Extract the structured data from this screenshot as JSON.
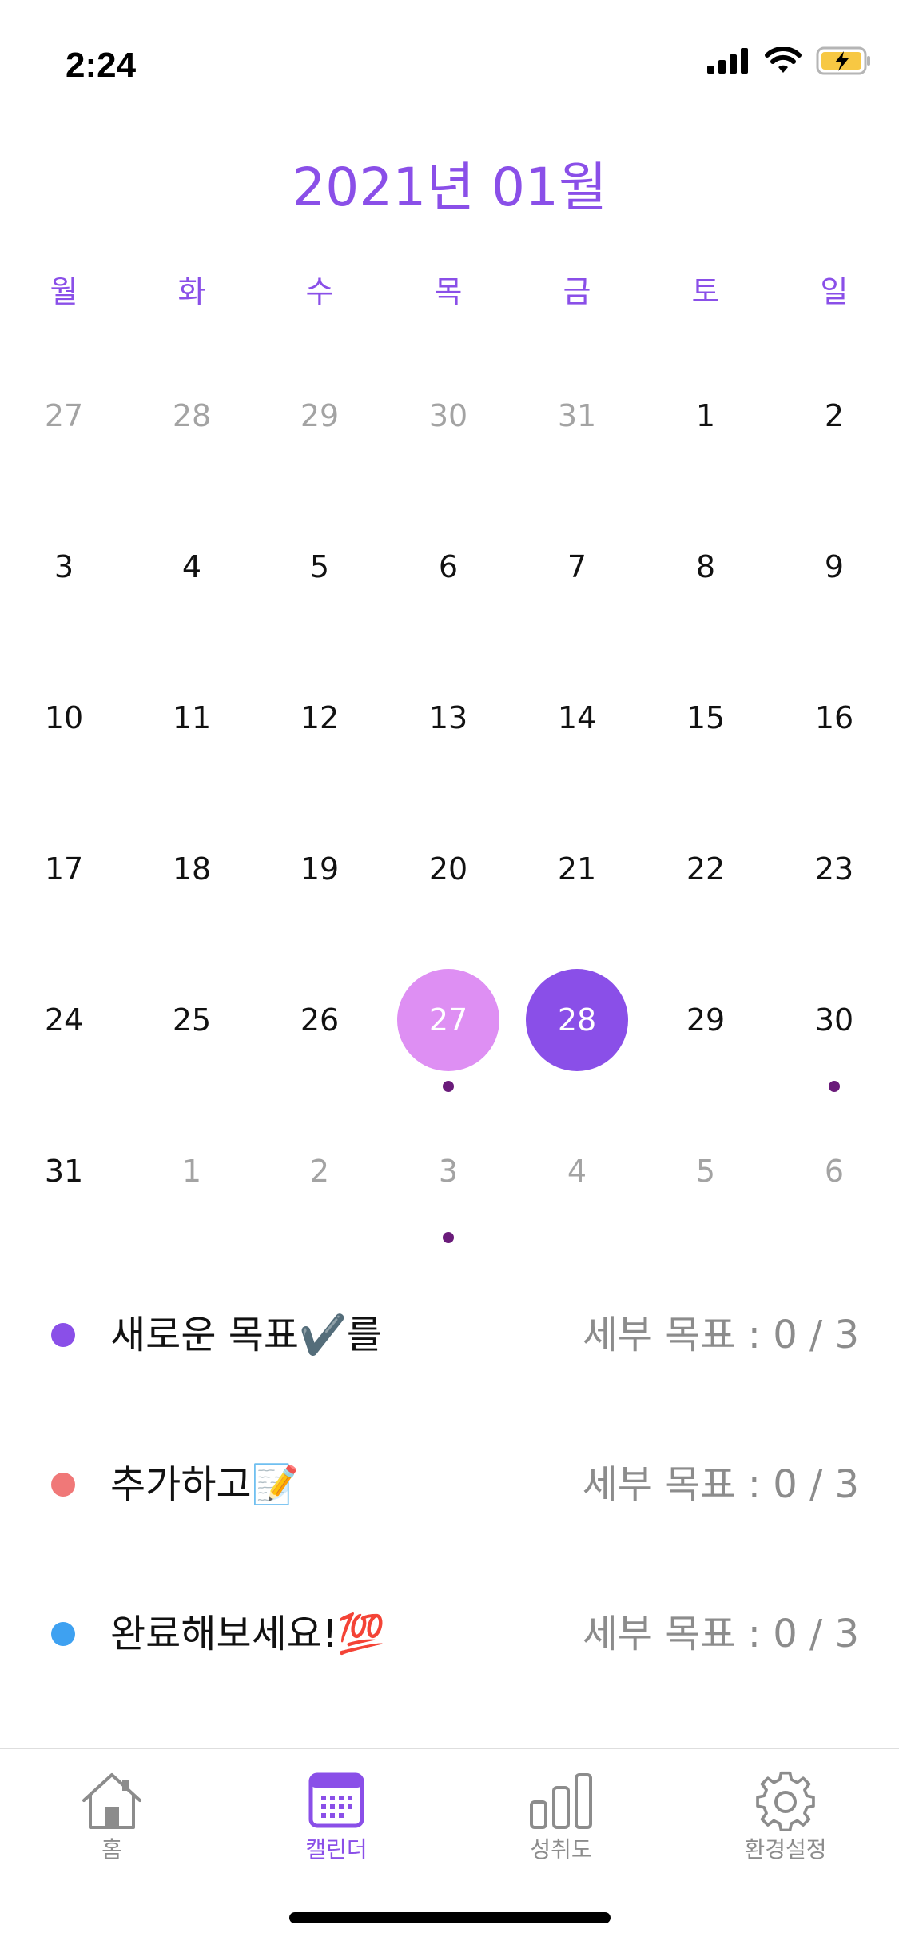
{
  "status_bar": {
    "time": "2:24",
    "icons": [
      "cellular-signal-icon",
      "wifi-icon",
      "battery-charging-icon"
    ]
  },
  "calendar": {
    "title": "2021년 01월",
    "weekdays": [
      "월",
      "화",
      "수",
      "목",
      "금",
      "토",
      "일"
    ],
    "weeks": [
      [
        {
          "day": "27",
          "current_month": false
        },
        {
          "day": "28",
          "current_month": false
        },
        {
          "day": "29",
          "current_month": false
        },
        {
          "day": "30",
          "current_month": false
        },
        {
          "day": "31",
          "current_month": false
        },
        {
          "day": "1",
          "current_month": true
        },
        {
          "day": "2",
          "current_month": true
        }
      ],
      [
        {
          "day": "3",
          "current_month": true
        },
        {
          "day": "4",
          "current_month": true
        },
        {
          "day": "5",
          "current_month": true
        },
        {
          "day": "6",
          "current_month": true
        },
        {
          "day": "7",
          "current_month": true
        },
        {
          "day": "8",
          "current_month": true
        },
        {
          "day": "9",
          "current_month": true
        }
      ],
      [
        {
          "day": "10",
          "current_month": true
        },
        {
          "day": "11",
          "current_month": true
        },
        {
          "day": "12",
          "current_month": true
        },
        {
          "day": "13",
          "current_month": true
        },
        {
          "day": "14",
          "current_month": true
        },
        {
          "day": "15",
          "current_month": true
        },
        {
          "day": "16",
          "current_month": true
        }
      ],
      [
        {
          "day": "17",
          "current_month": true
        },
        {
          "day": "18",
          "current_month": true
        },
        {
          "day": "19",
          "current_month": true
        },
        {
          "day": "20",
          "current_month": true
        },
        {
          "day": "21",
          "current_month": true
        },
        {
          "day": "22",
          "current_month": true
        },
        {
          "day": "23",
          "current_month": true
        }
      ],
      [
        {
          "day": "24",
          "current_month": true
        },
        {
          "day": "25",
          "current_month": true
        },
        {
          "day": "26",
          "current_month": true
        },
        {
          "day": "27",
          "current_month": true,
          "today": true,
          "has_event": true
        },
        {
          "day": "28",
          "current_month": true,
          "selected": true
        },
        {
          "day": "29",
          "current_month": true
        },
        {
          "day": "30",
          "current_month": true,
          "has_event": true
        }
      ],
      [
        {
          "day": "31",
          "current_month": true
        },
        {
          "day": "1",
          "current_month": false
        },
        {
          "day": "2",
          "current_month": false
        },
        {
          "day": "3",
          "current_month": false,
          "has_event": true
        },
        {
          "day": "4",
          "current_month": false
        },
        {
          "day": "5",
          "current_month": false
        },
        {
          "day": "6",
          "current_month": false
        }
      ]
    ]
  },
  "goals": [
    {
      "title": "새로운 목표✔️를",
      "progress": "세부 목표 : 0 / 3",
      "color": "#8a4fe8"
    },
    {
      "title": "추가하고📝",
      "progress": "세부 목표 : 0 / 3",
      "color": "#f07878"
    },
    {
      "title": "완료해보세요!💯",
      "progress": "세부 목표 : 0 / 3",
      "color": "#3ea1f1"
    }
  ],
  "tab_bar": {
    "items": [
      {
        "label": "홈",
        "icon": "home-icon",
        "active": false
      },
      {
        "label": "캘린더",
        "icon": "calendar-icon",
        "active": true
      },
      {
        "label": "성취도",
        "icon": "bar-chart-icon",
        "active": false
      },
      {
        "label": "환경설정",
        "icon": "gear-icon",
        "active": false
      }
    ]
  },
  "colors": {
    "accent": "#8a4fe8",
    "today_highlight": "#de8ff3",
    "event_dot": "#6a1b7a",
    "inactive": "#8c8c8c"
  }
}
